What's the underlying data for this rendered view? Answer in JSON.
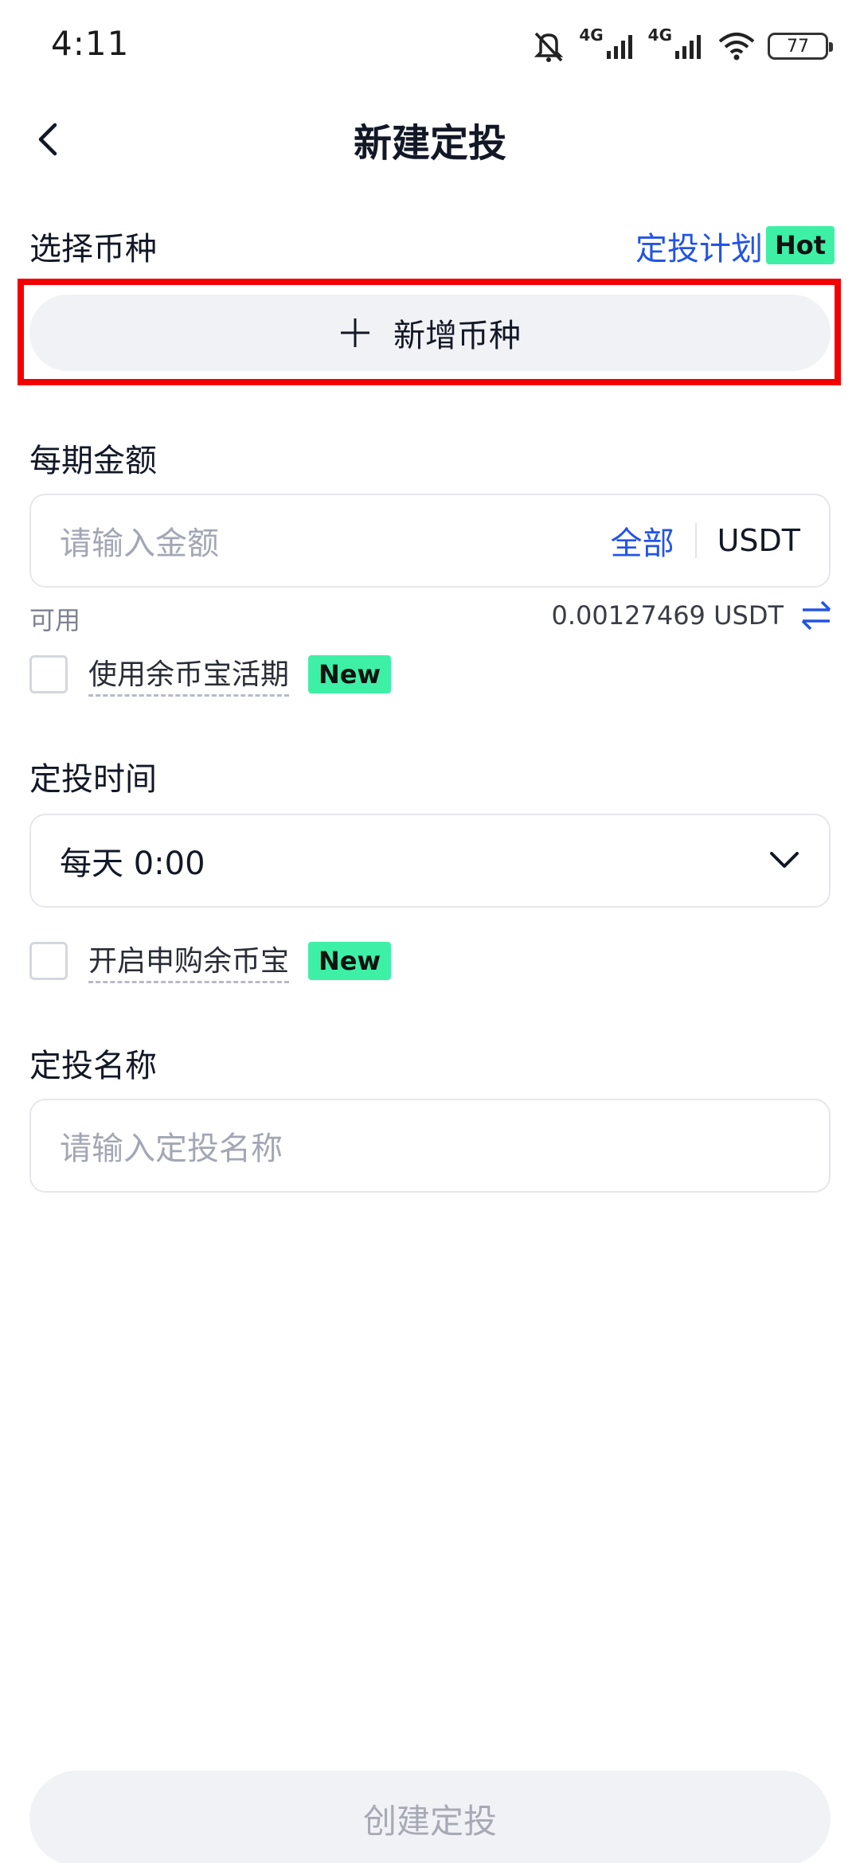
{
  "status_bar": {
    "time": "4:11",
    "net1": "4G",
    "net2": "4G",
    "battery": "77",
    "icons": [
      "mute-icon",
      "signal-icon",
      "signal-icon",
      "wifi-icon",
      "battery-icon"
    ]
  },
  "header": {
    "title": "新建定投",
    "back_icon": "chevron-left-icon"
  },
  "coin_section": {
    "label": "选择币种",
    "plan_link": "定投计划",
    "hot_badge": "Hot",
    "add_button": "新增币种",
    "add_icon": "plus-icon"
  },
  "amount_section": {
    "label": "每期金额",
    "placeholder": "请输入金额",
    "all_button": "全部",
    "currency": "USDT",
    "available_label": "可用",
    "balance": "0.00127469 USDT",
    "swap_icon": "swap-icon",
    "use_savings_label": "使用余币宝活期",
    "new_badge": "New"
  },
  "time_section": {
    "label": "定投时间",
    "value": "每天 0:00",
    "dropdown_icon": "chevron-down-icon",
    "subscribe_label": "开启申购余币宝",
    "new_badge": "New"
  },
  "name_section": {
    "label": "定投名称",
    "placeholder": "请输入定投名称"
  },
  "footer": {
    "create_button": "创建定投"
  },
  "colors": {
    "accent": "#2354e6",
    "badge": "#3ef0a6",
    "highlight": "#f40000",
    "button_bg": "#f1f2f6"
  }
}
